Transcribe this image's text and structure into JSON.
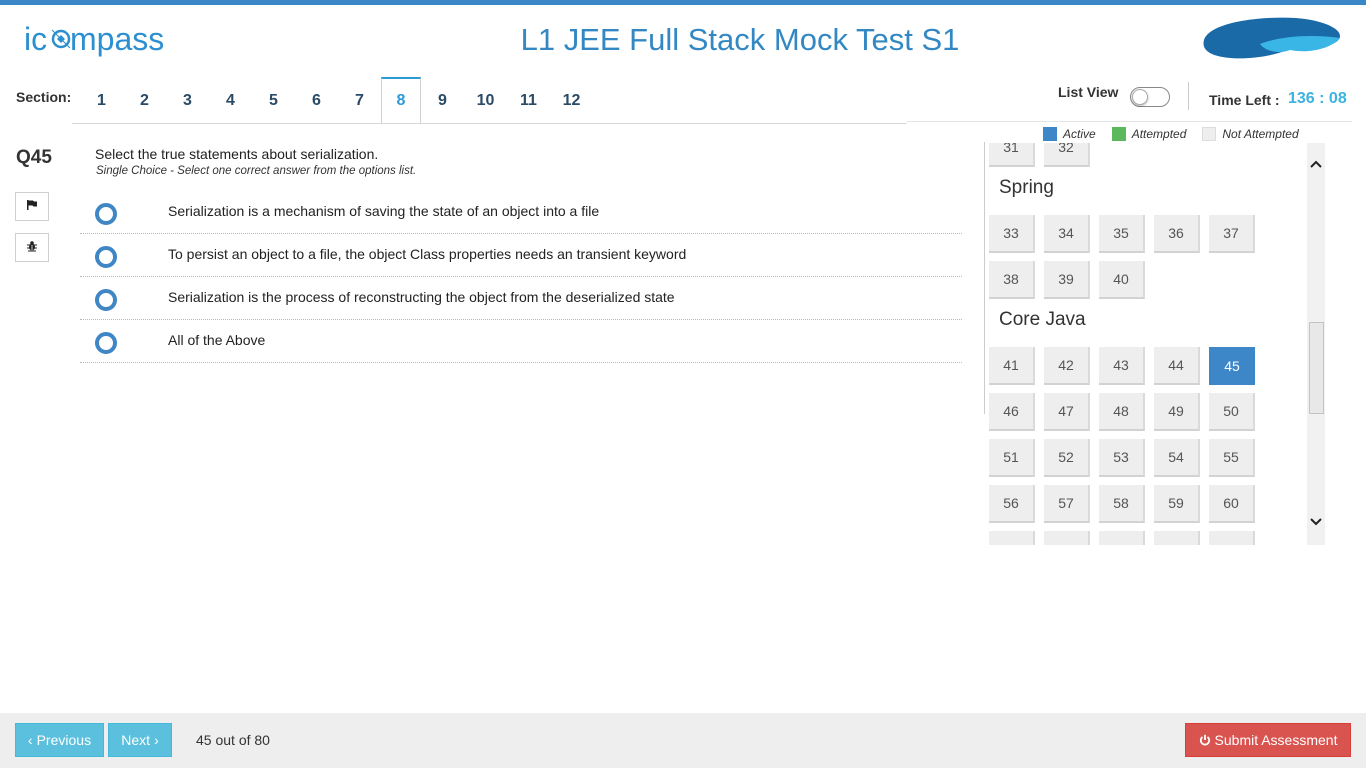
{
  "header": {
    "logo_text": "icompass",
    "title": "L1 JEE Full Stack Mock Test S1"
  },
  "sections": {
    "label": "Section:",
    "tabs": [
      "1",
      "2",
      "3",
      "4",
      "5",
      "6",
      "7",
      "8",
      "9",
      "10",
      "11",
      "12"
    ],
    "active": "8"
  },
  "controls": {
    "list_view_label": "List View",
    "list_view_on": false,
    "time_left_label": "Time Left :",
    "time_left_value": "136 : 08"
  },
  "question": {
    "number": "Q45",
    "text": "Select the true statements about serialization.",
    "hint": "Single Choice - Select one correct answer from the options list.",
    "options": [
      "Serialization is a mechanism of saving the state of an object into a file",
      "To persist an object to a file, the object Class properties needs an transient keyword",
      "Serialization is the process of reconstructing the object from the deserialized state",
      "All of the Above"
    ]
  },
  "legend": {
    "active_label": "Active",
    "attempted_label": "Attempted",
    "not_attempted_label": "Not Attempted",
    "active_color": "#3d86c8",
    "attempted_color": "#5cb85c",
    "not_attempted_color": "#eeeeee"
  },
  "palette": {
    "partial_top": [
      "31",
      "32"
    ],
    "groups": [
      {
        "title": "Spring",
        "numbers": [
          "33",
          "34",
          "35",
          "36",
          "37",
          "38",
          "39",
          "40"
        ]
      },
      {
        "title": "Core Java",
        "numbers": [
          "41",
          "42",
          "43",
          "44",
          "45",
          "46",
          "47",
          "48",
          "49",
          "50",
          "51",
          "52",
          "53",
          "54",
          "55",
          "56",
          "57",
          "58",
          "59",
          "60"
        ]
      }
    ],
    "active_number": "45"
  },
  "footer": {
    "previous_label": "Previous",
    "next_label": "Next",
    "progress": "45 out of 80",
    "submit_label": "Submit Assessment"
  }
}
